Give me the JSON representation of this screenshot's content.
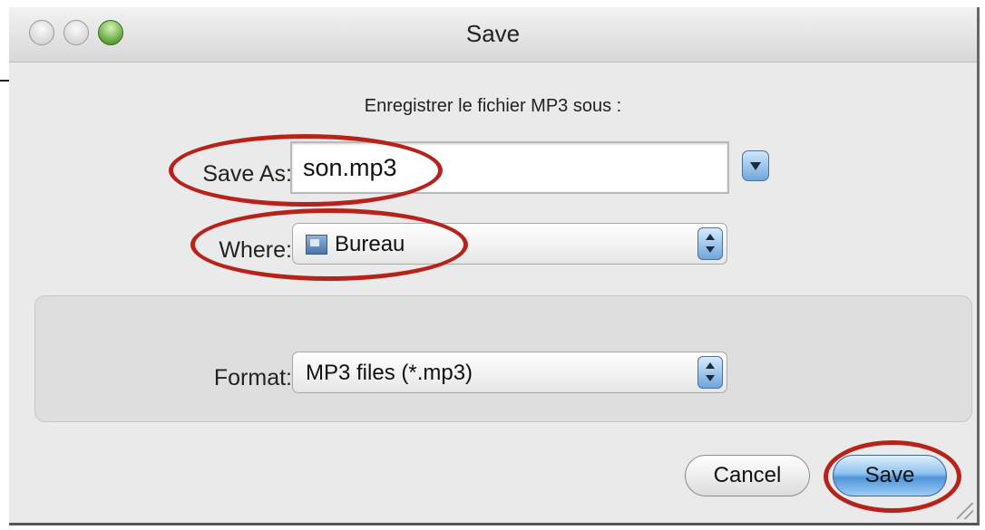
{
  "window": {
    "title": "Save"
  },
  "dialog": {
    "prompt": "Enregistrer le fichier MP3 sous :",
    "save_as_label": "Save As:",
    "save_as_value": "son.mp3",
    "where_label": "Where:",
    "where_value": "Bureau",
    "format_label": "Format:",
    "format_value": "MP3 files (*.mp3)"
  },
  "buttons": {
    "cancel_label": "Cancel",
    "save_label": "Save"
  },
  "colors": {
    "highlight": "#b7221b",
    "accent_button": "#4f94d8",
    "window_bg": "#eaeaea"
  },
  "icons": {
    "folder": "folder-icon",
    "expand": "disclosure-triangle-icon",
    "popup_arrows": "up-down-arrows-icon"
  }
}
